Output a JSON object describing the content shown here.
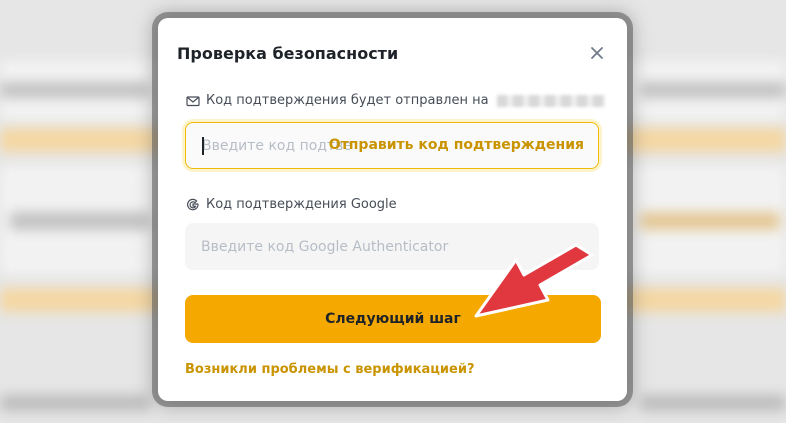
{
  "dialog": {
    "title": "Проверка безопасности",
    "email_field": {
      "label": "Код подтверждения будет отправлен на",
      "placeholder": "Введите код подтверждения",
      "send_code_label": "Отправить код подтверждения"
    },
    "google_field": {
      "label": "Код подтверждения Google",
      "placeholder": "Введите код Google Authenticator"
    },
    "next_button_label": "Следующий шаг",
    "help_link_label": "Возникли проблемы с верификацией?"
  },
  "colors": {
    "accent": "#f5a800",
    "link": "#c99400",
    "annotation_arrow": "#e0383e"
  },
  "icons": {
    "close": "close-icon",
    "email": "mail-icon",
    "google": "google-icon"
  }
}
